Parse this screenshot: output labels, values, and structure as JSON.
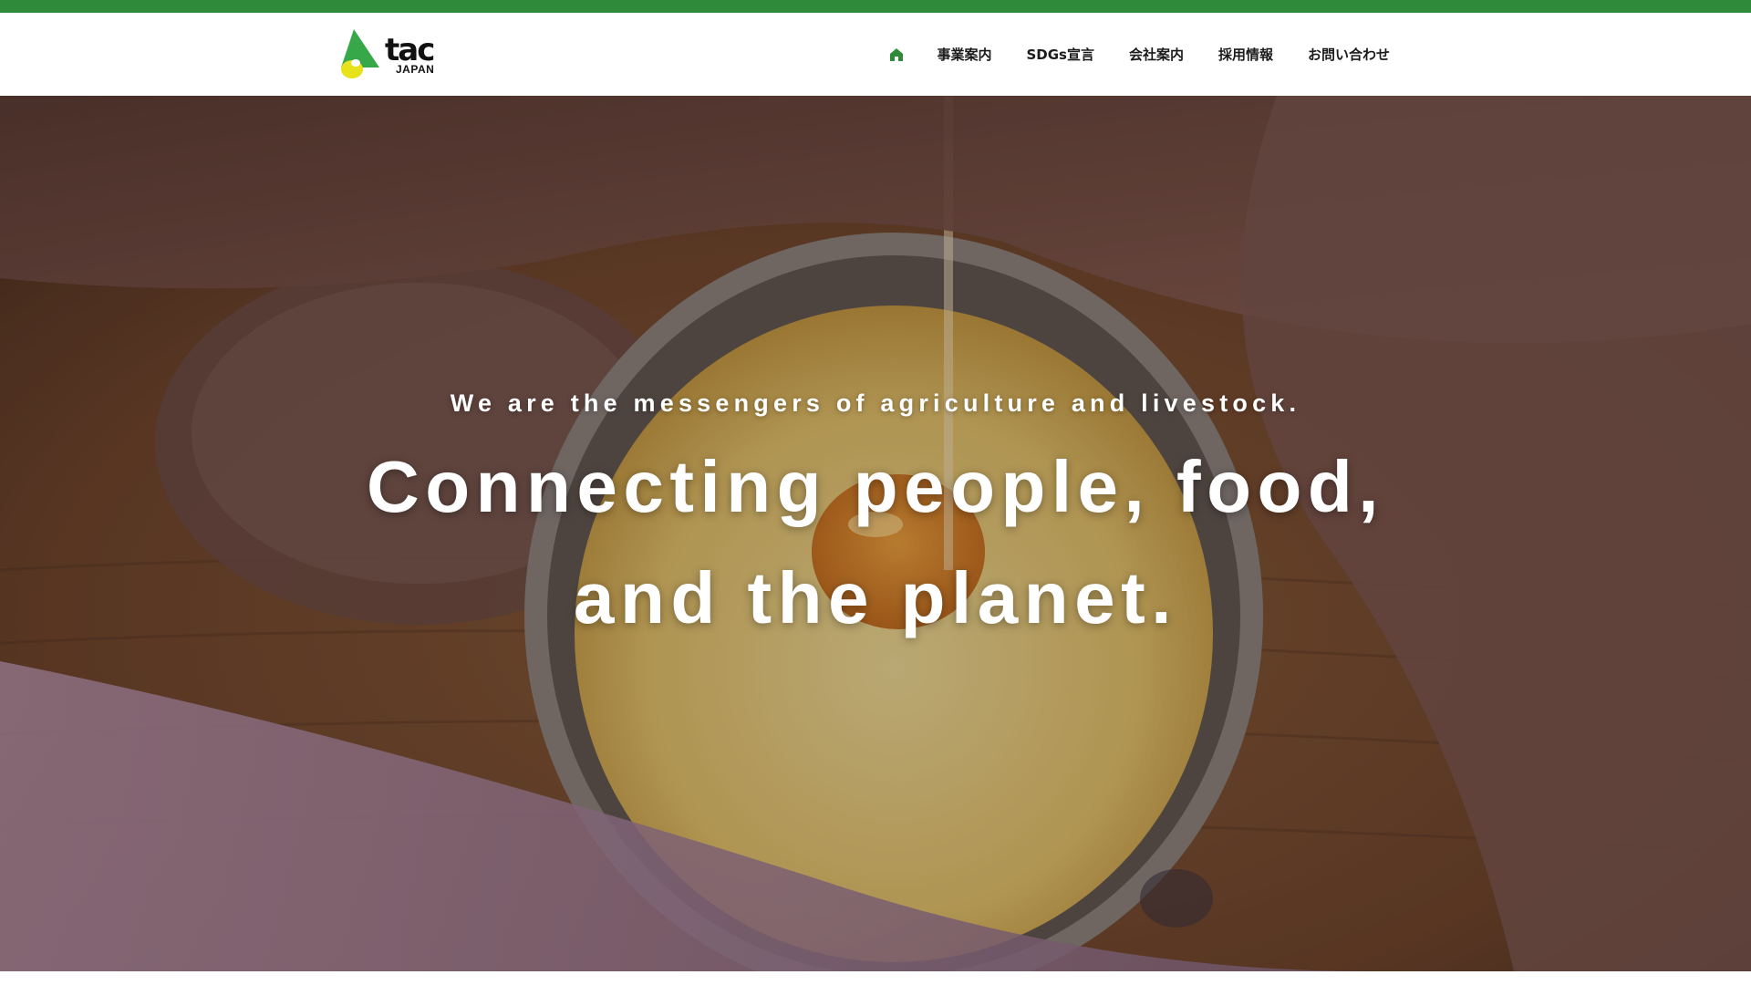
{
  "colors": {
    "accent_green": "#2f8a3a",
    "logo_yellow": "#e8e21a",
    "logo_green": "#36a84a",
    "text_dark": "#1b1b1b"
  },
  "header": {
    "logo_sub": "JAPAN",
    "home_icon": "home-icon",
    "nav": [
      {
        "label": "事業案内"
      },
      {
        "label": "SDGs宣言"
      },
      {
        "label": "会社案内"
      },
      {
        "label": "採用情報"
      },
      {
        "label": "お問い合わせ"
      }
    ]
  },
  "hero": {
    "tagline": "We are the messengers of agriculture and livestock.",
    "headline_line1": "Connecting people, food,",
    "headline_line2": "and the planet."
  }
}
